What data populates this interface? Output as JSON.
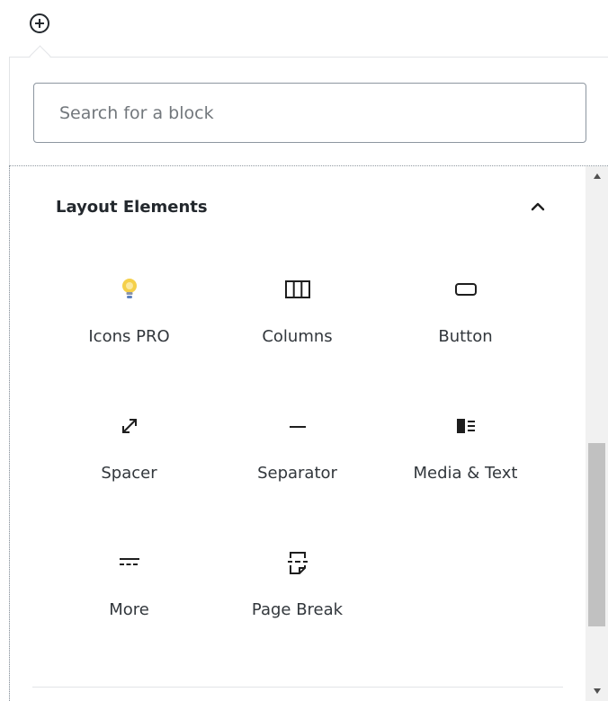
{
  "inserter": {
    "icon": "plus-circle-icon"
  },
  "search": {
    "placeholder": "Search for a block",
    "value": ""
  },
  "panel": {
    "title": "Layout Elements",
    "expanded": true,
    "toggle_icon": "chevron-up-icon"
  },
  "blocks": [
    {
      "label": "Icons PRO",
      "icon": "lightbulb-icon",
      "icon_color": "#f5d04a"
    },
    {
      "label": "Columns",
      "icon": "columns-icon"
    },
    {
      "label": "Button",
      "icon": "button-icon"
    },
    {
      "label": "Spacer",
      "icon": "resize-arrows-icon"
    },
    {
      "label": "Separator",
      "icon": "separator-icon"
    },
    {
      "label": "Media & Text",
      "icon": "media-text-icon"
    },
    {
      "label": "More",
      "icon": "more-icon"
    },
    {
      "label": "Page Break",
      "icon": "page-break-icon"
    }
  ],
  "colors": {
    "text": "#32373c",
    "border": "#8d96a0",
    "scrollbar_thumb": "#c1c1c1"
  }
}
